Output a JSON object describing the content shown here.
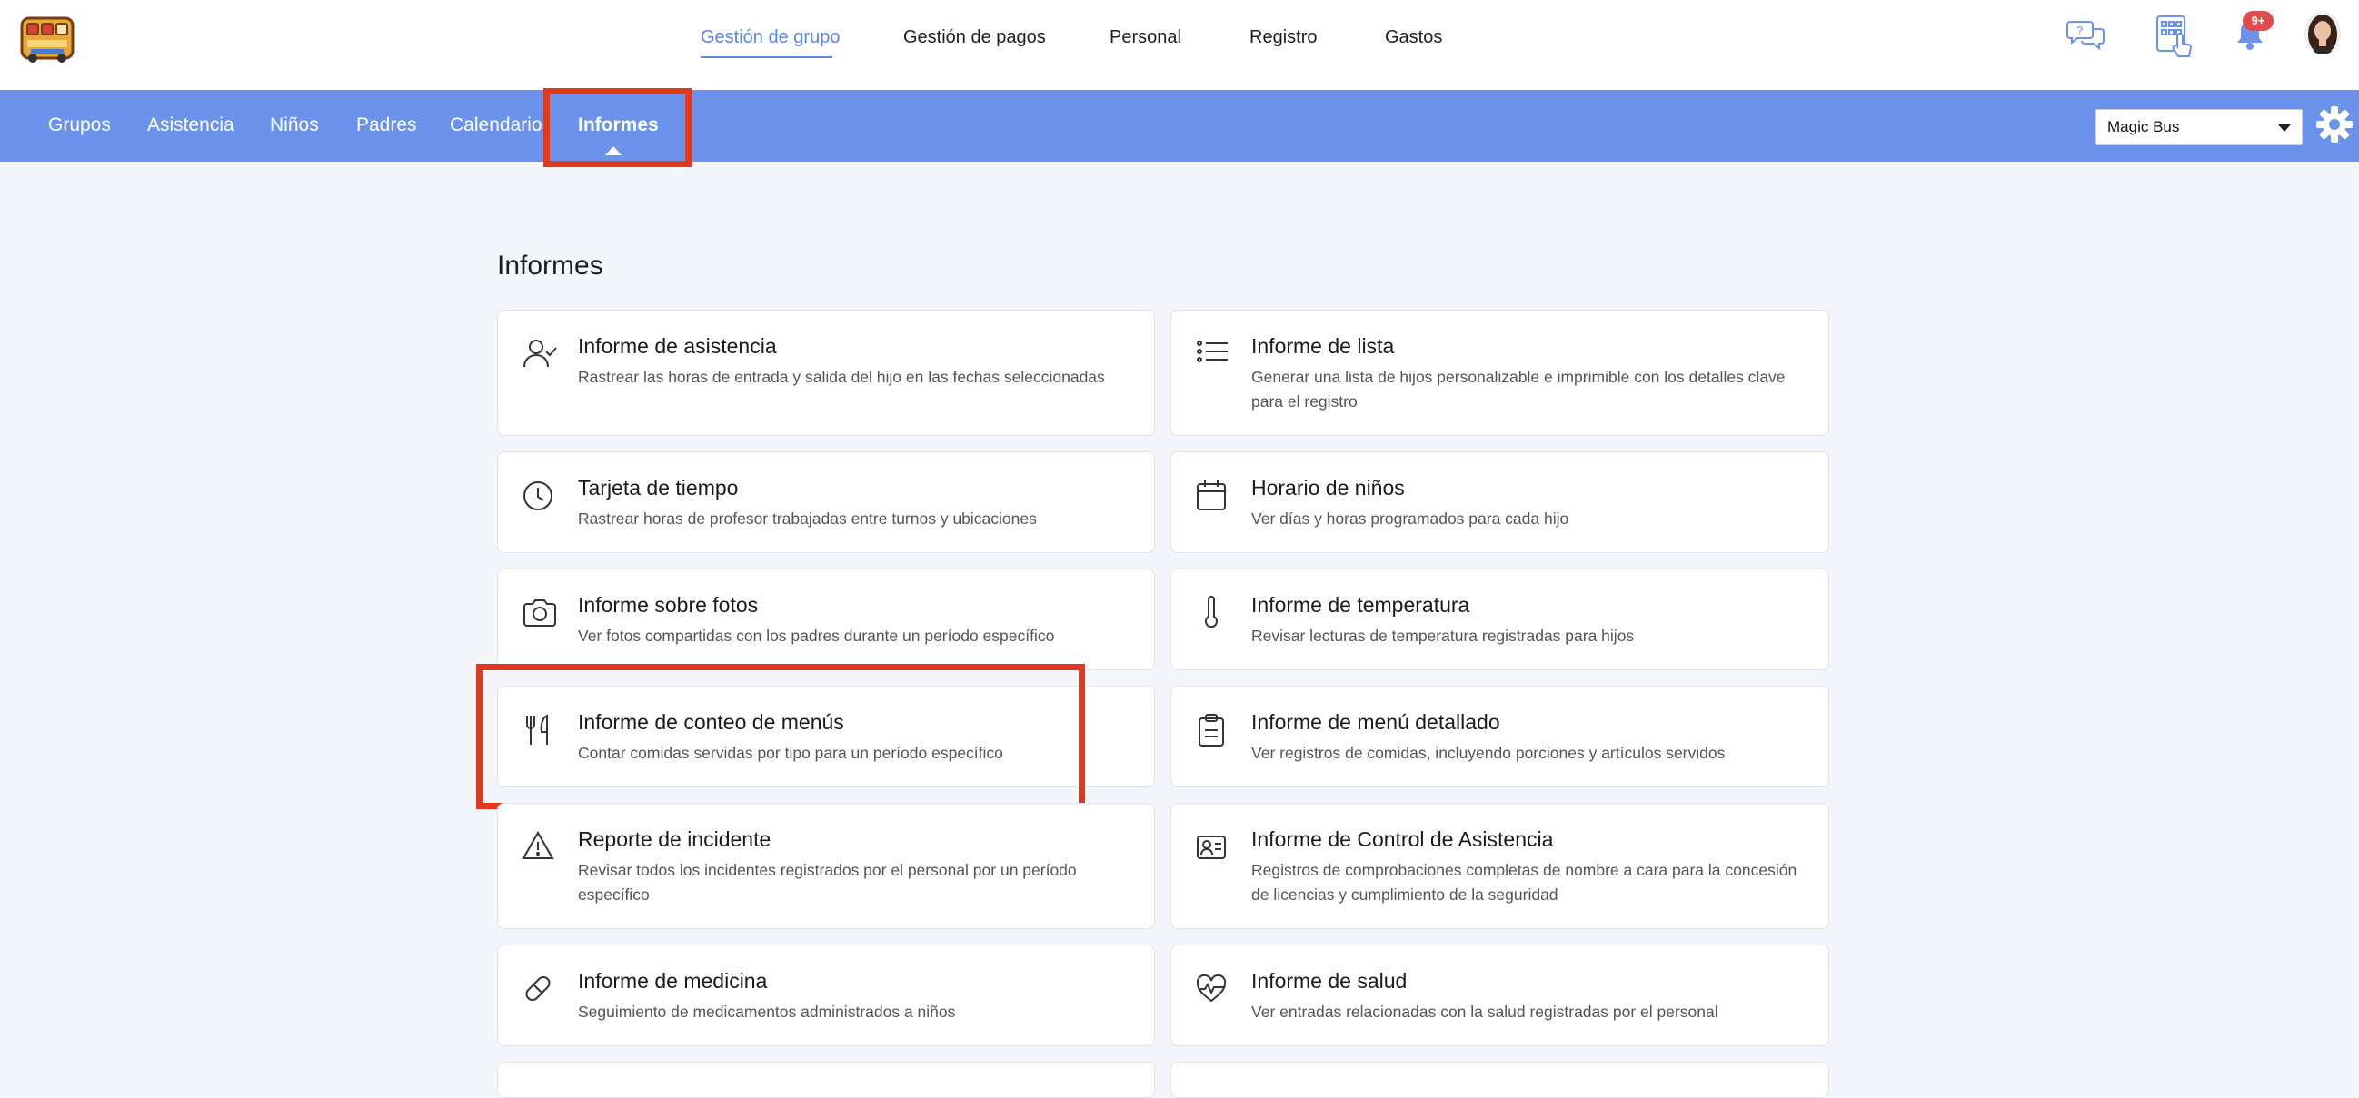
{
  "header": {
    "nav": [
      {
        "label": "Gestión de grupo",
        "active": true
      },
      {
        "label": "Gestión de pagos",
        "active": false
      },
      {
        "label": "Personal",
        "active": false
      },
      {
        "label": "Registro",
        "active": false
      },
      {
        "label": "Gastos",
        "active": false
      }
    ],
    "notification_badge": "9+",
    "icons": [
      "help-chat-icon",
      "kiosk-checkin-icon",
      "bell-icon",
      "avatar"
    ]
  },
  "subnav": {
    "items": [
      {
        "label": "Grupos"
      },
      {
        "label": "Asistencia"
      },
      {
        "label": "Niños"
      },
      {
        "label": "Padres"
      },
      {
        "label": "Calendario"
      },
      {
        "label": "Informes",
        "active": true
      }
    ],
    "school_select": {
      "value": "Magic Bus"
    }
  },
  "main": {
    "title": "Informes",
    "reports": [
      {
        "title": "Informe de asistencia",
        "desc": "Rastrear las horas de entrada y salida del hijo en las fechas seleccionadas",
        "icon": "user-check-icon"
      },
      {
        "title": "Informe de lista",
        "desc": "Generar una lista de hijos personalizable e imprimible con los detalles clave para el registro",
        "icon": "list-icon"
      },
      {
        "title": "Tarjeta de tiempo",
        "desc": "Rastrear horas de profesor trabajadas entre turnos y ubicaciones",
        "icon": "clock-icon"
      },
      {
        "title": "Horario de niños",
        "desc": "Ver días y horas programados para cada hijo",
        "icon": "calendar-icon"
      },
      {
        "title": "Informe sobre fotos",
        "desc": "Ver fotos compartidas con los padres durante un período específico",
        "icon": "camera-icon"
      },
      {
        "title": "Informe de temperatura",
        "desc": "Revisar lecturas de temperatura registradas para hijos",
        "icon": "thermometer-icon"
      },
      {
        "title": "Informe de conteo de menús",
        "desc": "Contar comidas servidas por tipo para un período específico",
        "icon": "utensils-icon"
      },
      {
        "title": "Informe de menú detallado",
        "desc": "Ver registros de comidas, incluyendo porciones y artículos servidos",
        "icon": "clipboard-icon"
      },
      {
        "title": "Reporte de incidente",
        "desc": "Revisar todos los incidentes registrados por el personal por un período específico",
        "icon": "warning-icon"
      },
      {
        "title": "Informe de Control de Asistencia",
        "desc": "Registros de comprobaciones completas de nombre a cara para la concesión de licencias y cumplimiento de la seguridad",
        "icon": "id-card-icon"
      },
      {
        "title": "Informe de medicina",
        "desc": "Seguimiento de medicamentos administrados a niños",
        "icon": "pill-icon"
      },
      {
        "title": "Informe de salud",
        "desc": "Ver entradas relacionadas con la salud registradas por el personal",
        "icon": "heart-pulse-icon"
      }
    ]
  },
  "colors": {
    "accent": "#5b86e5",
    "subnav_bg": "#6c93ec",
    "highlight": "#e03a1e",
    "badge": "#e24b4b"
  }
}
